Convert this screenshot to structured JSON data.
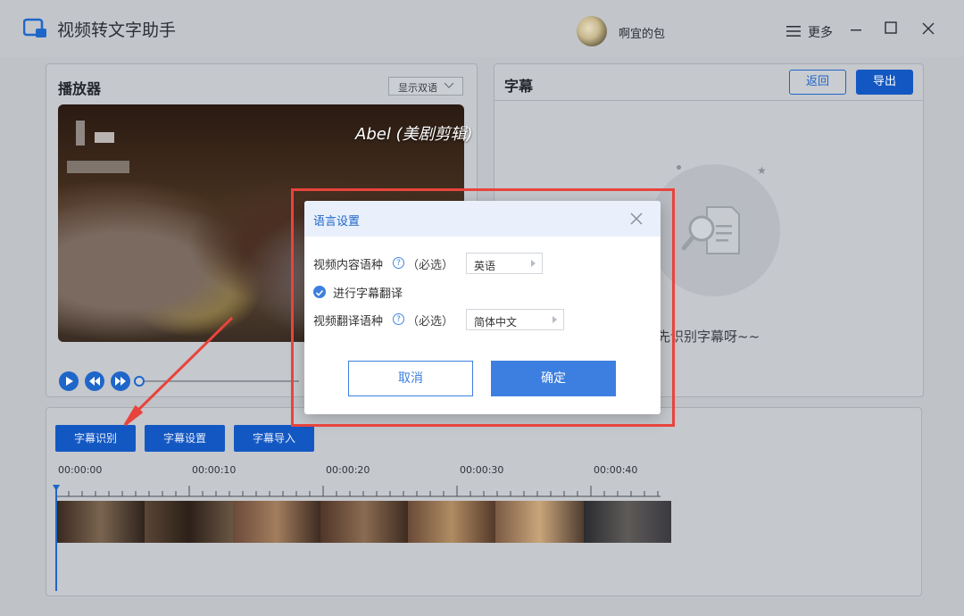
{
  "app": {
    "title": "视频转文字助手"
  },
  "user": {
    "name": "啊宜的包"
  },
  "menu": {
    "more_label": "更多"
  },
  "player": {
    "title": "播放器",
    "language_select": "显示双语",
    "watermark": "Abel (美剧剪辑)"
  },
  "subtitle": {
    "title": "字幕",
    "back_label": "返回",
    "export_label": "导出",
    "empty_text": "先识别字幕呀~~"
  },
  "toolbar": {
    "recognize_label": "字幕识别",
    "settings_label": "字幕设置",
    "import_label": "字幕导入"
  },
  "timeline": {
    "ticks": [
      "00:00:00",
      "00:00:10",
      "00:00:20",
      "00:00:30",
      "00:00:40"
    ]
  },
  "dialog": {
    "title": "语言设置",
    "content_language_label": "视频内容语种",
    "required": "（必选）",
    "content_language_value": "英语",
    "translate_checkbox_label": "进行字幕翻译",
    "translate_checked": true,
    "translate_language_label": "视频翻译语种",
    "translate_language_value": "简体中文",
    "cancel_label": "取消",
    "confirm_label": "确定"
  },
  "colors": {
    "primary": "#1358c2",
    "dialog_accent": "#3d7fe0",
    "annotation_red": "#e8443d"
  }
}
